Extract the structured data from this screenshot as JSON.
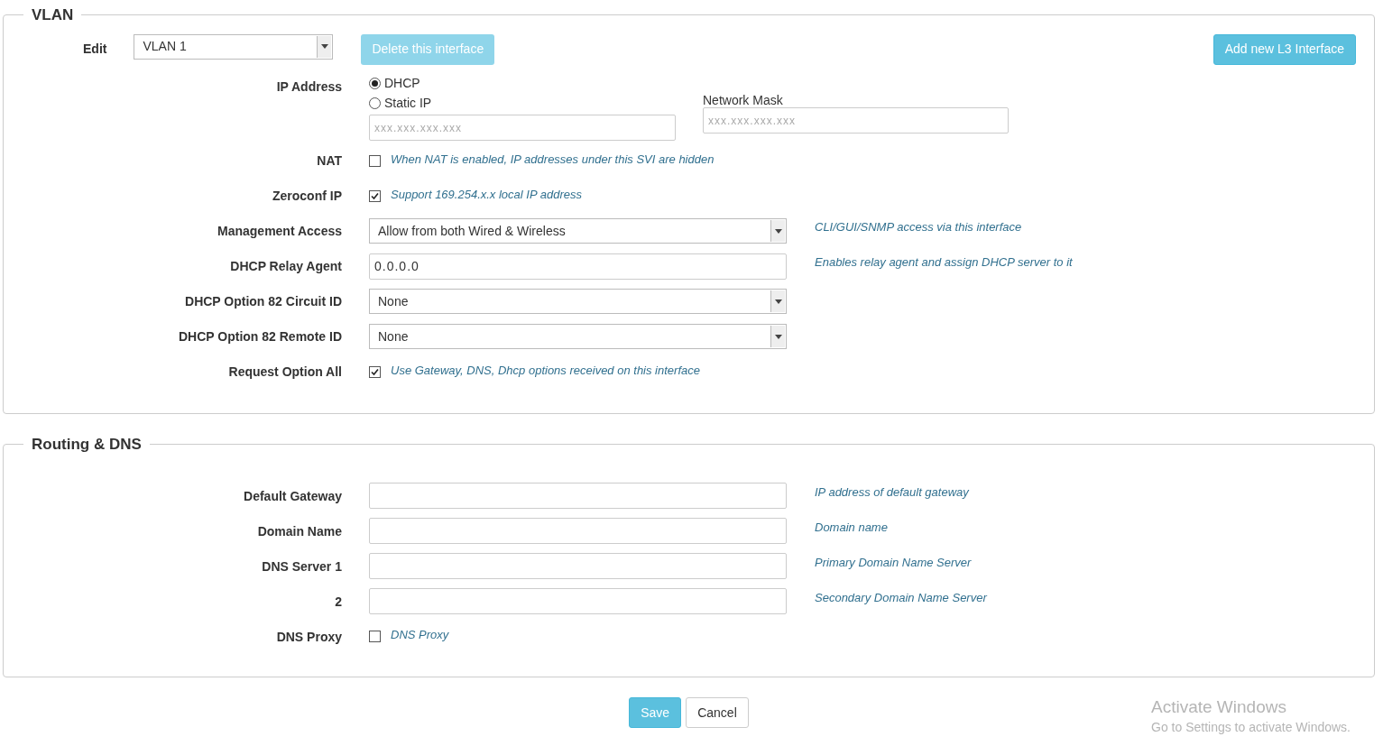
{
  "vlan": {
    "legend": "VLAN",
    "edit": {
      "label": "Edit",
      "value": "VLAN 1"
    },
    "delete_button": {
      "label": "Delete this interface",
      "disabled": true
    },
    "add_button": {
      "label": "Add new L3 Interface"
    },
    "ip_address": {
      "label": "IP Address",
      "options": [
        {
          "label": "DHCP",
          "selected": true
        },
        {
          "label": "Static IP",
          "selected": false
        }
      ],
      "ip_placeholder": "xxx.xxx.xxx.xxx",
      "network_mask_label": "Network Mask",
      "mask_placeholder": "xxx.xxx.xxx.xxx"
    },
    "rows": [
      {
        "kind": "checkbox",
        "label": "NAT",
        "checked": false,
        "help": "When NAT is enabled, IP addresses under this SVI are hidden"
      },
      {
        "kind": "checkbox",
        "label": "Zeroconf IP",
        "checked": true,
        "help": "Support 169.254.x.x local IP address"
      },
      {
        "kind": "select",
        "label": "Management Access",
        "value": "Allow from both Wired & Wireless",
        "help": "CLI/GUI/SNMP access via this interface"
      },
      {
        "kind": "text",
        "label": "DHCP Relay Agent",
        "value": "0.0.0.0",
        "help": "Enables relay agent and assign DHCP server to it"
      },
      {
        "kind": "select",
        "label": "DHCP Option 82 Circuit ID",
        "value": "None"
      },
      {
        "kind": "select",
        "label": "DHCP Option 82 Remote ID",
        "value": "None"
      },
      {
        "kind": "checkbox",
        "label": "Request Option All",
        "checked": true,
        "help": "Use Gateway, DNS, Dhcp options received on this interface"
      }
    ]
  },
  "routing_dns": {
    "legend": "Routing & DNS",
    "rows": [
      {
        "kind": "text",
        "label": "Default Gateway",
        "help": "IP address of default gateway"
      },
      {
        "kind": "text",
        "label": "Domain Name",
        "help": "Domain name"
      },
      {
        "kind": "text",
        "label": "DNS Server 1",
        "help": "Primary Domain Name Server"
      },
      {
        "kind": "text",
        "label": "2",
        "help": "Secondary Domain Name Server"
      },
      {
        "kind": "checkbox",
        "label": "DNS Proxy",
        "checked": false,
        "help": "DNS Proxy"
      }
    ]
  },
  "buttons": [
    {
      "kind": "primary",
      "label": "Save"
    },
    {
      "kind": "default",
      "label": "Cancel"
    }
  ],
  "os_notice": {
    "title": "Activate Windows",
    "subtitle": "Go to Settings to activate Windows."
  }
}
